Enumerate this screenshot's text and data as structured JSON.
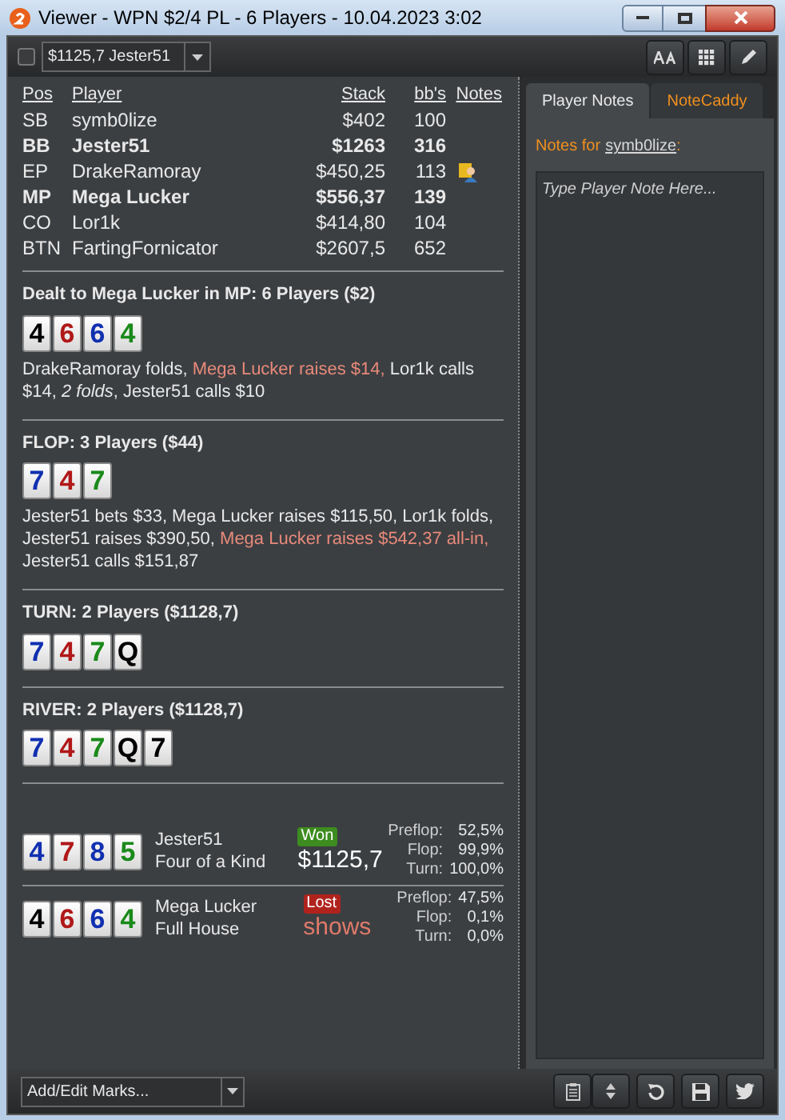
{
  "window": {
    "title": "Viewer - WPN $2/4 PL - 6 Players - 10.04.2023 3:02"
  },
  "toolbar": {
    "checkbox": {
      "checked": false
    },
    "hand_select": {
      "value": "$1125,7 Jester51"
    }
  },
  "players": {
    "columns": [
      "Pos",
      "Player",
      "Stack",
      "bb's",
      "Notes"
    ],
    "rows": [
      {
        "pos": "SB",
        "player": "symb0lize",
        "stack": "$402",
        "bbs": "100",
        "bold": false,
        "has_note": false
      },
      {
        "pos": "BB",
        "player": "Jester51",
        "stack": "$1263",
        "bbs": "316",
        "bold": true,
        "has_note": false
      },
      {
        "pos": "EP",
        "player": "DrakeRamoray",
        "stack": "$450,25",
        "bbs": "113",
        "bold": false,
        "has_note": true
      },
      {
        "pos": "MP",
        "player": "Mega Lucker",
        "stack": "$556,37",
        "bbs": "139",
        "bold": true,
        "has_note": false
      },
      {
        "pos": "CO",
        "player": "Lor1k",
        "stack": "$414,80",
        "bbs": "104",
        "bold": false,
        "has_note": false
      },
      {
        "pos": "BTN",
        "player": "FartingFornicator",
        "stack": "$2607,5",
        "bbs": "652",
        "bold": false,
        "has_note": false
      }
    ]
  },
  "streets": [
    {
      "title": "Dealt to Mega Lucker in MP: 6 Players ($2)",
      "cards": [
        {
          "rank": "4",
          "color": "#000000"
        },
        {
          "rank": "6",
          "color": "#b01818"
        },
        {
          "rank": "6",
          "color": "#1030b0"
        },
        {
          "rank": "4",
          "color": "#1a8a1a"
        }
      ],
      "actions": [
        {
          "text": "DrakeRamoray folds, ",
          "kind": "plain"
        },
        {
          "text": "Mega Lucker raises $14,",
          "kind": "hero"
        },
        {
          "text": " Lor1k calls $14, ",
          "kind": "plain"
        },
        {
          "text": "2 folds",
          "kind": "italic"
        },
        {
          "text": ", Jester51 calls $10",
          "kind": "plain"
        }
      ]
    },
    {
      "title": "FLOP: 3 Players ($44)",
      "cards": [
        {
          "rank": "7",
          "color": "#1030b0"
        },
        {
          "rank": "4",
          "color": "#b01818"
        },
        {
          "rank": "7",
          "color": "#1a8a1a"
        }
      ],
      "actions": [
        {
          "text": "Jester51 bets $33, Mega Lucker raises $115,50, Lor1k folds, Jester51 raises $390,50, ",
          "kind": "plain"
        },
        {
          "text": "Mega Lucker raises $542,37 all-in,",
          "kind": "hero"
        },
        {
          "text": " Jester51 calls $151,87",
          "kind": "plain"
        }
      ]
    },
    {
      "title": "TURN: 2 Players ($1128,7)",
      "cards": [
        {
          "rank": "7",
          "color": "#1030b0"
        },
        {
          "rank": "4",
          "color": "#b01818"
        },
        {
          "rank": "7",
          "color": "#1a8a1a"
        },
        {
          "rank": "Q",
          "color": "#000000"
        }
      ]
    },
    {
      "title": "RIVER: 2 Players ($1128,7)",
      "cards": [
        {
          "rank": "7",
          "color": "#1030b0"
        },
        {
          "rank": "4",
          "color": "#b01818"
        },
        {
          "rank": "7",
          "color": "#1a8a1a"
        },
        {
          "rank": "Q",
          "color": "#000000"
        },
        {
          "rank": "7",
          "color": "#000000"
        }
      ]
    }
  ],
  "showdown": [
    {
      "cards": [
        {
          "rank": "4",
          "color": "#1030b0"
        },
        {
          "rank": "7",
          "color": "#b01818"
        },
        {
          "rank": "8",
          "color": "#1030b0"
        },
        {
          "rank": "5",
          "color": "#1a8a1a"
        }
      ],
      "player": "Jester51",
      "hand": "Four of a Kind",
      "result": {
        "label": "Won",
        "won": true
      },
      "amount": "$1125,7",
      "equity": [
        {
          "label": "Preflop:",
          "value": "52,5%"
        },
        {
          "label": "Flop:",
          "value": "99,9%"
        },
        {
          "label": "Turn:",
          "value": "100,0%"
        }
      ]
    },
    {
      "cards": [
        {
          "rank": "4",
          "color": "#000000"
        },
        {
          "rank": "6",
          "color": "#b01818"
        },
        {
          "rank": "6",
          "color": "#1030b0"
        },
        {
          "rank": "4",
          "color": "#1a8a1a"
        }
      ],
      "player": "Mega Lucker",
      "hand": "Full House",
      "result": {
        "label": "Lost",
        "won": false
      },
      "amount": "shows",
      "equity": [
        {
          "label": "Preflop:",
          "value": "47,5%"
        },
        {
          "label": "Flop:",
          "value": "0,1%"
        },
        {
          "label": "Turn:",
          "value": "0,0%"
        }
      ]
    }
  ],
  "notes_panel": {
    "tabs": [
      {
        "label": "Player Notes",
        "selected": true
      },
      {
        "label": "NoteCaddy",
        "selected": false
      }
    ],
    "notes_for": "Notes for",
    "player": "symb0lize",
    "suffix": ":",
    "placeholder": "Type Player Note Here..."
  },
  "bottom_bar": {
    "marks_select": {
      "value": "Add/Edit Marks..."
    }
  }
}
